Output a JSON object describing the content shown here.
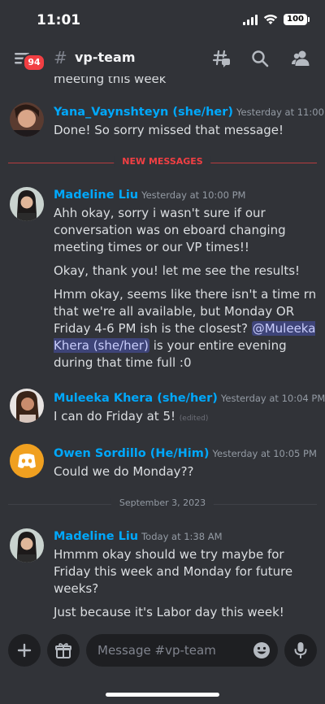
{
  "status_bar": {
    "time": "11:01",
    "battery": "100"
  },
  "header": {
    "notification_count": "94",
    "channel": "vp-team"
  },
  "cutoff_text": "meeting this week",
  "messages": [
    {
      "author": "Yana_Vaynshteyn (she/her)",
      "timestamp": "Yesterday at 11:00 AM",
      "lines": [
        "Done! So sorry missed that message!"
      ]
    },
    {
      "author": "Madeline Liu",
      "timestamp": "Yesterday at 10:00 PM",
      "lines": [
        "Ahh okay, sorry i wasn't sure if our conversation was on eboard changing meeting times or our VP times!!",
        "Okay, thank you! let me see the results!",
        "Hmm okay, seems like there isn't a time rn that we're all available, but Monday OR Friday 4-6 PM ish  is the closest?",
        "is your entire evening during that time full :0"
      ],
      "mention": "@Muleeka Khera (she/her)"
    },
    {
      "author": "Muleeka Khera (she/her)",
      "timestamp": "Yesterday at 10:04 PM",
      "lines": [
        "I can do Friday at 5!"
      ],
      "edited": "(edited)"
    },
    {
      "author": "Owen Sordillo (He/Him)",
      "timestamp": "Yesterday at 10:05 PM",
      "lines": [
        "Could we do Monday??"
      ]
    },
    {
      "author": "Madeline Liu",
      "timestamp": "Today at 1:38 AM",
      "lines": [
        "Hmmm okay should we try maybe for Friday this week and Monday for future weeks?",
        "Just because it's Labor day this week!"
      ]
    }
  ],
  "dividers": {
    "new_messages": "NEW MESSAGES",
    "date": "September 3, 2023"
  },
  "composer": {
    "placeholder": "Message #vp-team"
  },
  "colors": {
    "background": "#313338",
    "accent": "#00a8fc",
    "new_messages": "#f23f43",
    "mention_bg": "#5865f2"
  }
}
